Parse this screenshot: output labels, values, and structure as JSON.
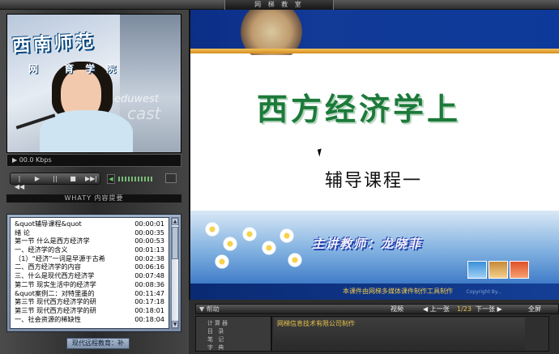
{
  "header": {
    "tab_title": "网 梯 教 室"
  },
  "video": {
    "logo_line1": "西南师范",
    "logo_line2": "网  育学院",
    "watermark1": "eduwest",
    "watermark2": "cast",
    "status_text": "▶ 00.0 Kbps"
  },
  "player": {
    "buttons": [
      "|◀◀",
      "▶",
      "||",
      "■",
      "▶▶|"
    ],
    "volume_icon": "◀",
    "brand": "WHATY",
    "contents_label": "内容提要"
  },
  "outline": {
    "items": [
      {
        "title": "&quot辅导课程&quot",
        "time": "00:00:01"
      },
      {
        "title": "绪  论",
        "time": "00:00:35"
      },
      {
        "title": "第一节   什么是西方经济学",
        "time": "00:00:53"
      },
      {
        "title": "一、经济学的含义",
        "time": "00:01:13"
      },
      {
        "title": "（1）“经济”一词是早源于古希",
        "time": "00:02:38"
      },
      {
        "title": "二、西方经济学的内容",
        "time": "00:06:16"
      },
      {
        "title": "三、什么是现代西方经济学",
        "time": "00:07:48"
      },
      {
        "title": "第二节  现实生活中的经济学",
        "time": "00:08:36"
      },
      {
        "title": "&quot案例二：对特里墨的",
        "time": "00:11:47"
      },
      {
        "title": "第三节  现代西方经济学的研",
        "time": "00:17:18"
      },
      {
        "title": "第三节  现代西方经济学的研",
        "time": "00:18:01"
      },
      {
        "title": "一、社会资源的稀缺性",
        "time": "00:18:04"
      }
    ],
    "footer": "现代远程教育：补"
  },
  "slide": {
    "title": "西方经济学上",
    "subtitle": "辅导课程一",
    "lecturer": "主讲教师：龙晓菲",
    "footer_text": "本课件由网梯多媒体课件制作工具制作",
    "footer_small": "Copyright By..."
  },
  "toolbar": {
    "help": "▼ 帮助",
    "video": "视频",
    "prev": "◀ 上一张",
    "page": "1/23",
    "next": "下一张 ▶",
    "fullscreen": "全屏",
    "panel_labels": [
      "计算器",
      "目  录",
      "笔  记",
      "字  典"
    ],
    "marquee": "网梯信息技术有限公司制作"
  },
  "colors": {
    "slide_title": "#1c7a3a",
    "band_blue": "#0b2e86",
    "accent_gold": "#e8c24a"
  }
}
